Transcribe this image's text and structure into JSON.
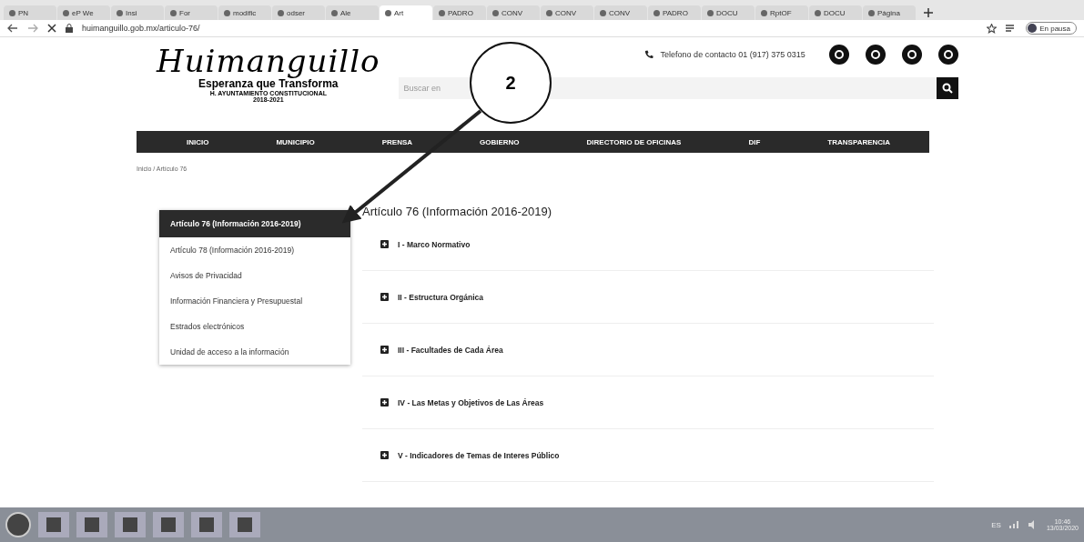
{
  "browser": {
    "tabs": [
      {
        "label": "PN",
        "selected": false
      },
      {
        "label": "eP We",
        "selected": false
      },
      {
        "label": "Insi",
        "selected": false
      },
      {
        "label": "For",
        "selected": false
      },
      {
        "label": "modific",
        "selected": false
      },
      {
        "label": "odser",
        "selected": false
      },
      {
        "label": "Ale",
        "selected": false
      },
      {
        "label": "Art",
        "selected": true
      },
      {
        "label": "PADRO",
        "selected": false
      },
      {
        "label": "CONV",
        "selected": false
      },
      {
        "label": "CONV",
        "selected": false
      },
      {
        "label": "CONV",
        "selected": false
      },
      {
        "label": "PADRO",
        "selected": false
      },
      {
        "label": "DOCU",
        "selected": false
      },
      {
        "label": "RptOF",
        "selected": false
      },
      {
        "label": "DOCU",
        "selected": false
      },
      {
        "label": "Página",
        "selected": false
      }
    ],
    "url": "huimanguillo.gob.mx/articulo-76/",
    "profile": "En pausa"
  },
  "header": {
    "logo_script": "Huimanguillo",
    "slogan": "Esperanza que Transforma",
    "council": "H. AYUNTAMIENTO CONSTITUCIONAL",
    "period": "2018-2021",
    "phone": "Telefono de contacto 01 (917) 375 0315",
    "search": {
      "placeholder": "Buscar en"
    }
  },
  "nav": [
    {
      "label": "INICIO"
    },
    {
      "label": "MUNICIPIO"
    },
    {
      "label": "PRENSA"
    },
    {
      "label": "GOBIERNO"
    },
    {
      "label": "DIRECTORIO DE OFICINAS"
    },
    {
      "label": "DIF"
    },
    {
      "label": "TRANSPARENCIA"
    }
  ],
  "breadcrumb": "Inicio / Artículo 76",
  "sidebar": [
    {
      "label": "Artículo 76 (Información 2016-2019)",
      "selected": true
    },
    {
      "label": "Artículo 78 (Información 2016-2019)",
      "selected": false
    },
    {
      "label": "Avisos de Privacidad",
      "selected": false
    },
    {
      "label": "Información Financiera y Presupuestal",
      "selected": false
    },
    {
      "label": "Estrados electrónicos",
      "selected": false
    },
    {
      "label": "Unidad de acceso a la información",
      "selected": false
    }
  ],
  "content": {
    "title": "Artículo 76 (Información 2016-2019)",
    "sections": [
      {
        "label": "I - Marco Normativo",
        "expanded": false
      },
      {
        "label": "II - Estructura Orgánica",
        "expanded": false
      },
      {
        "label": "III - Facultades de Cada Área",
        "expanded": false
      },
      {
        "label": "IV - Las Metas y Objetivos de Las Áreas",
        "expanded": false
      },
      {
        "label": "V - Indicadores de Temas de Interes Público",
        "expanded": false
      }
    ]
  },
  "annotation": {
    "label": "2"
  },
  "taskbar": {
    "language": "ES",
    "time": "10:46",
    "date": "13/03/2020"
  }
}
